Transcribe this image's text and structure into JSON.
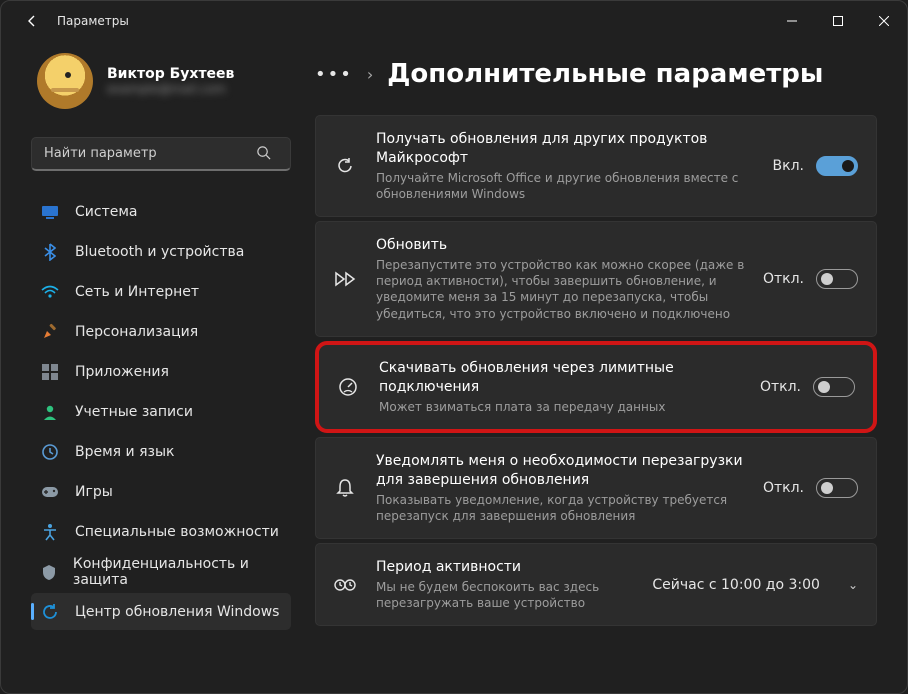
{
  "title": "Параметры",
  "user": {
    "name": "Виктор Бухтеев",
    "email": "example@mail.com"
  },
  "search": {
    "placeholder": "Найти параметр"
  },
  "sidebar": {
    "items": [
      {
        "label": "Система",
        "icon": "system",
        "color": "#2a74d0"
      },
      {
        "label": "Bluetooth и устройства",
        "icon": "bluetooth",
        "color": "#3a8ee6"
      },
      {
        "label": "Сеть и Интернет",
        "icon": "wifi",
        "color": "#1cb0e8"
      },
      {
        "label": "Персонализация",
        "icon": "brush",
        "color": "#e57c35"
      },
      {
        "label": "Приложения",
        "icon": "apps",
        "color": "#7f8790"
      },
      {
        "label": "Учетные записи",
        "icon": "account",
        "color": "#2ec27e"
      },
      {
        "label": "Время и язык",
        "icon": "time",
        "color": "#5a9bd5"
      },
      {
        "label": "Игры",
        "icon": "games",
        "color": "#8c9aa6"
      },
      {
        "label": "Специальные возможности",
        "icon": "accessibility",
        "color": "#4aa3e0"
      },
      {
        "label": "Конфиденциальность и защита",
        "icon": "privacy",
        "color": "#8c9aa6"
      },
      {
        "label": "Центр обновления Windows",
        "icon": "update",
        "color": "#1e90d8",
        "active": true
      }
    ]
  },
  "page": {
    "title": "Дополнительные параметры"
  },
  "cards": [
    {
      "icon": "sync",
      "title": "Получать обновления для других продуктов Майкрософт",
      "desc": "Получайте Microsoft Office и другие обновления вместе с обновлениями Windows",
      "state": "Вкл.",
      "on": true
    },
    {
      "icon": "ff",
      "title": "Обновить",
      "desc": "Перезапустите это устройство как можно скорее (даже в период активности), чтобы завершить обновление, и уведомите меня за 15 минут до перезапуска, чтобы убедиться, что это устройство включено и подключено",
      "state": "Откл.",
      "on": false
    },
    {
      "icon": "metered",
      "title": "Скачивать обновления через лимитные подключения",
      "desc": "Может взиматься плата за передачу данных",
      "state": "Откл.",
      "on": false,
      "hl": true
    },
    {
      "icon": "bell",
      "title": "Уведомлять меня о необходимости перезагрузки для завершения обновления",
      "desc": "Показывать уведомление, когда устройству требуется перезапуск для завершения обновления",
      "state": "Откл.",
      "on": false
    },
    {
      "icon": "activity",
      "title": "Период активности",
      "desc": "Мы не будем беспокоить вас здесь перезагружать ваше устройство",
      "state": "Сейчас с 10:00 до 3:00",
      "arrow": true
    }
  ]
}
